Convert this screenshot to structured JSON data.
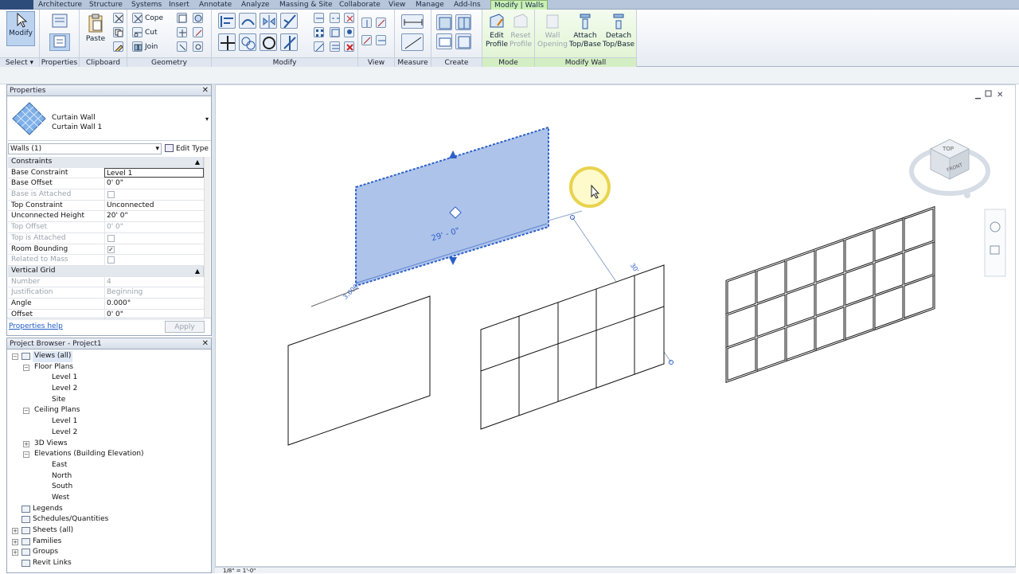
{
  "ribbon_tabs": [
    "Architecture",
    "Structure",
    "Systems",
    "Insert",
    "Annotate",
    "Analyze",
    "Massing & Site",
    "Collaborate",
    "View",
    "Manage",
    "Add-Ins",
    "Modify | Walls"
  ],
  "ribbon": {
    "select": {
      "modify": "Modify",
      "label": "Select"
    },
    "properties": {
      "label": "Properties"
    },
    "clipboard": {
      "paste": "Paste",
      "label": "Clipboard"
    },
    "geometry": {
      "cope": "Cope",
      "cut": "Cut",
      "join": "Join",
      "label": "Geometry"
    },
    "modify": {
      "label": "Modify"
    },
    "view": {
      "label": "View"
    },
    "measure": {
      "label": "Measure"
    },
    "create": {
      "label": "Create"
    },
    "mode": {
      "edit_profile": [
        "Edit",
        "Profile"
      ],
      "reset_profile": [
        "Reset",
        "Profile"
      ],
      "label": "Mode"
    },
    "modify_wall": {
      "wall_opening": [
        "Wall",
        "Opening"
      ],
      "attach": [
        "Attach",
        "Top/Base"
      ],
      "detach": [
        "Detach",
        "Top/Base"
      ],
      "label": "Modify Wall"
    }
  },
  "properties_panel": {
    "title": "Properties",
    "family": "Curtain Wall",
    "type": "Curtain Wall 1",
    "filter": "Walls (1)",
    "edit_type": "Edit Type",
    "rows": [
      {
        "kind": "group",
        "key": "Constraints"
      },
      {
        "key": "Base Constraint",
        "value": "Level 1",
        "selected": true
      },
      {
        "key": "Base Offset",
        "value": "0'  0\""
      },
      {
        "key": "Base is Attached",
        "value": "",
        "check": "",
        "disabled": true
      },
      {
        "key": "Top Constraint",
        "value": "Unconnected"
      },
      {
        "key": "Unconnected Height",
        "value": "20'  0\""
      },
      {
        "key": "Top Offset",
        "value": "0'  0\"",
        "disabled": true
      },
      {
        "key": "Top is Attached",
        "value": "",
        "check": "",
        "disabled": true
      },
      {
        "key": "Room Bounding",
        "value": "",
        "check": "✓"
      },
      {
        "key": "Related to Mass",
        "value": "",
        "check": "",
        "disabled": true
      },
      {
        "kind": "group",
        "key": "Vertical Grid"
      },
      {
        "key": "Number",
        "value": "4",
        "disabled": true
      },
      {
        "key": "Justification",
        "value": "Beginning",
        "disabled": true
      },
      {
        "key": "Angle",
        "value": "0.000°"
      },
      {
        "key": "Offset",
        "value": "0'  0\""
      }
    ],
    "help": "Properties help",
    "apply": "Apply"
  },
  "project_browser": {
    "title": "Project Browser - Project1",
    "nodes": [
      {
        "label": "Views (all)",
        "level": 0,
        "exp": "−",
        "icon": true
      },
      {
        "label": "Floor Plans",
        "level": 1,
        "exp": "−"
      },
      {
        "label": "Level 1",
        "level": 2
      },
      {
        "label": "Level 2",
        "level": 2
      },
      {
        "label": "Site",
        "level": 2
      },
      {
        "label": "Ceiling Plans",
        "level": 1,
        "exp": "−"
      },
      {
        "label": "Level 1",
        "level": 2
      },
      {
        "label": "Level 2",
        "level": 2
      },
      {
        "label": "3D Views",
        "level": 1,
        "exp": "+"
      },
      {
        "label": "Elevations (Building Elevation)",
        "level": 1,
        "exp": "−"
      },
      {
        "label": "East",
        "level": 2
      },
      {
        "label": "North",
        "level": 2
      },
      {
        "label": "South",
        "level": 2
      },
      {
        "label": "West",
        "level": 2
      },
      {
        "label": "Legends",
        "level": 0,
        "icon": true
      },
      {
        "label": "Schedules/Quantities",
        "level": 0,
        "icon": true
      },
      {
        "label": "Sheets (all)",
        "level": 0,
        "exp": "+",
        "icon": true
      },
      {
        "label": "Families",
        "level": 0,
        "exp": "+",
        "icon": true
      },
      {
        "label": "Groups",
        "level": 0,
        "exp": "+",
        "icon": true
      },
      {
        "label": "Revit Links",
        "level": 0,
        "icon": true
      }
    ]
  },
  "view": {
    "dim_length": "29' - 0\"",
    "dim_thickness": "3.000\"",
    "dim_diag": "30' - 1 15/256\"",
    "viewcube_top": "TOP",
    "viewcube_front": "FRONT",
    "scale": "1/8\" = 1'-0\""
  },
  "colors": {
    "ribbon_tab_active": "#c9f0b5",
    "selection": "#2d5fc8",
    "fill": "#9fb8e6"
  }
}
